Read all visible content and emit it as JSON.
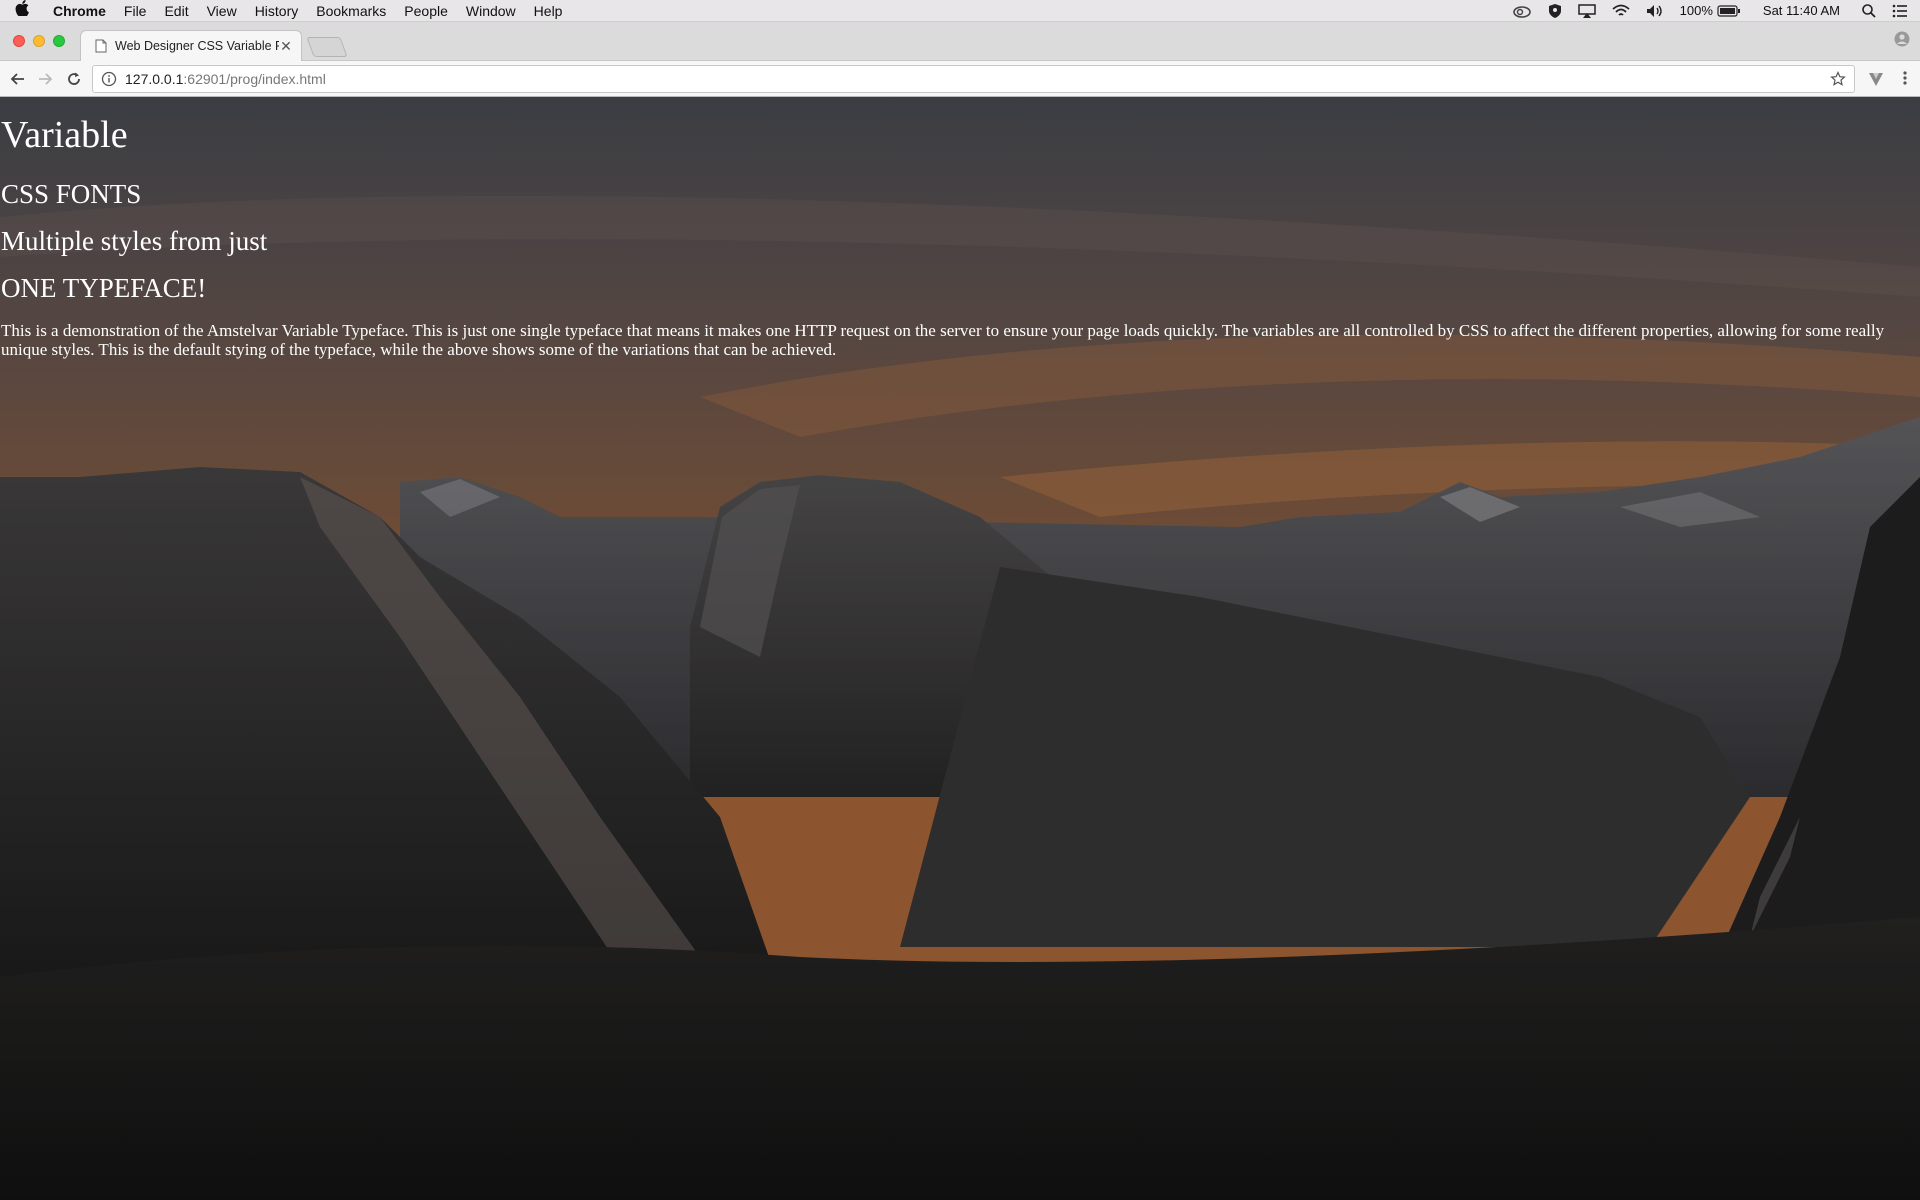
{
  "menubar": {
    "app_name": "Chrome",
    "items": [
      "File",
      "Edit",
      "View",
      "History",
      "Bookmarks",
      "People",
      "Window",
      "Help"
    ],
    "battery": "100%",
    "clock": "Sat 11:40 AM"
  },
  "tabs": [
    {
      "title": "Web Designer CSS Variable Fo",
      "active": true
    }
  ],
  "toolbar": {
    "url_host": "127.0.0.1",
    "url_rest": ":62901/prog/index.html"
  },
  "page": {
    "heading_1": "Variable",
    "heading_2": "CSS FONTS",
    "heading_3": "Multiple styles from just",
    "heading_4": "ONE TYPEFACE!",
    "paragraph": "This is a demonstration of the Amstelvar Variable Typeface. This is just one single typeface that means it makes one HTTP request on the server to ensure your page loads quickly. The variables are all controlled by CSS to affect the different properties, allowing for some really unique styles. This is the default stying of the typeface, while the above shows some of the variations that can be achieved."
  },
  "icons": {
    "apple": "apple-icon",
    "favicon": "page-icon",
    "back": "back-arrow-icon",
    "forward": "forward-arrow-icon",
    "reload": "reload-icon",
    "info": "info-icon",
    "star": "bookmark-star-icon",
    "menu": "kebab-menu-icon"
  }
}
